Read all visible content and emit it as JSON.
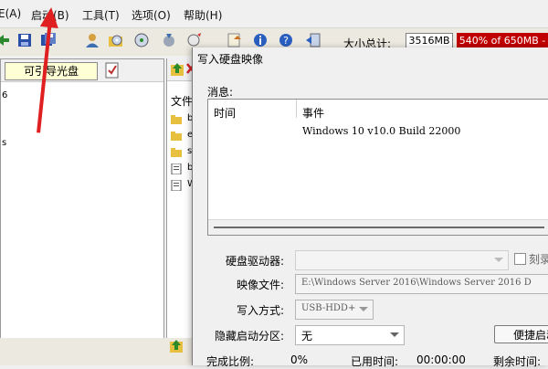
{
  "menu": {
    "items": [
      {
        "label": "E(A)",
        "key": "action"
      },
      {
        "label": "启动(B)",
        "key": "boot"
      },
      {
        "label": "工具(T)",
        "key": "tools"
      },
      {
        "label": "选项(O)",
        "key": "options"
      },
      {
        "label": "帮助(H)",
        "key": "help"
      }
    ]
  },
  "toolbar": {
    "size_total_label": "大小总计:",
    "size_total_value": "3516MB",
    "capacity_text": "540% of 650MB -",
    "capacity_color": "#c00000"
  },
  "left_panel": {
    "disc_label": "可引导光盘",
    "tree_items": [
      "6",
      "s"
    ]
  },
  "middle_panel": {
    "header_text": "文件",
    "files": [
      "b",
      "e",
      "s",
      "b",
      "W"
    ]
  },
  "dialog": {
    "title": "写入硬盘映像",
    "message_label": "消息:",
    "columns": {
      "time": "时间",
      "event": "事件"
    },
    "messages": [
      {
        "time": "",
        "event": "Windows 10 v10.0 Build 22000"
      }
    ],
    "disk_drive_label": "硬盘驱动器:",
    "disk_drive_value": "",
    "burn_check_label": "刻录",
    "image_file_label": "映像文件:",
    "image_file_value": "E:\\Windows Server 2016\\Windows Server 2016 D",
    "write_mode_label": "写入方式:",
    "write_mode_value": "USB-HDD+",
    "hidden_partition_label": "隐藏启动分区:",
    "hidden_partition_value": "无",
    "shortcut_button_label": "便捷启动",
    "progress": {
      "completion_label": "完成比例:",
      "completion_value": "0%",
      "elapsed_label": "已用时间:",
      "elapsed_value": "00:00:00",
      "remaining_label": "剩余时间:"
    }
  },
  "annotation": {
    "color": "#e02020"
  }
}
